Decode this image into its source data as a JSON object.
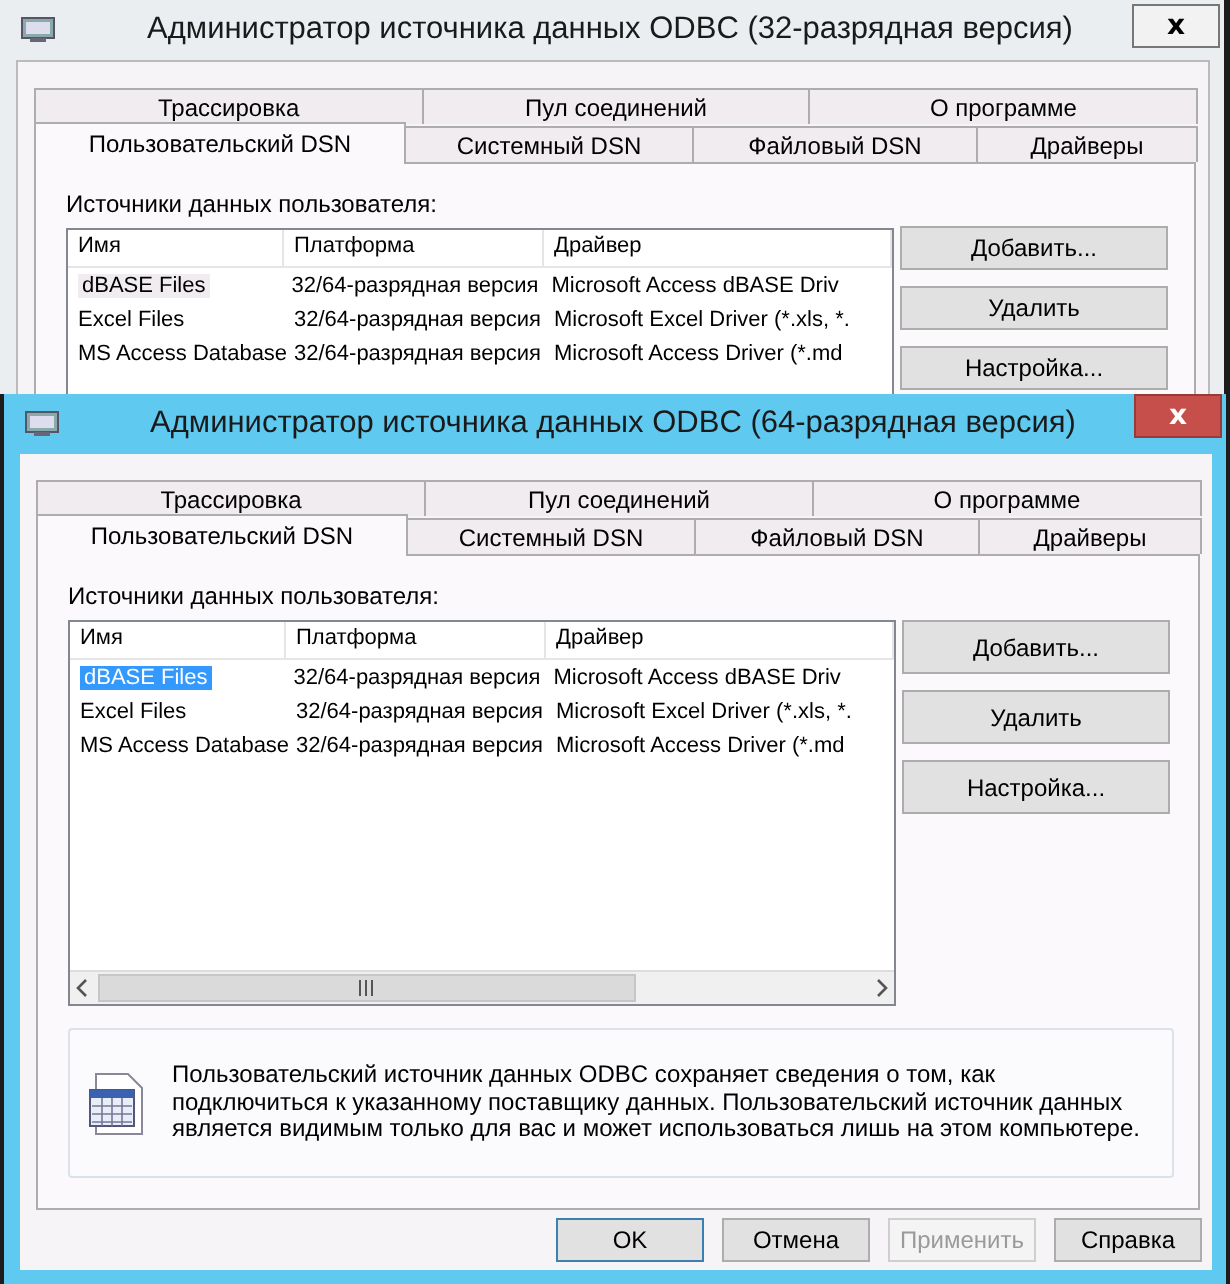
{
  "windows": [
    {
      "kind": "back",
      "active": false,
      "title": "Администратор источника данных ODBC (32-разрядная версия)",
      "close": "x",
      "tabs_top": [
        {
          "label": "Трассировка",
          "selected": false
        },
        {
          "label": "Пул соединений",
          "selected": false
        },
        {
          "label": "О программе",
          "selected": false
        }
      ],
      "tabs_bottom": [
        {
          "label": "Пользовательский DSN",
          "selected": true
        },
        {
          "label": "Системный DSN",
          "selected": false
        },
        {
          "label": "Файловый DSN",
          "selected": false
        },
        {
          "label": "Драйверы",
          "selected": false
        }
      ],
      "list_label": "Источники данных пользователя:",
      "table": {
        "columns": [
          "Имя",
          "Платформа",
          "Драйвер"
        ],
        "rows": [
          {
            "cells": [
              "dBASE Files",
              "32/64-разрядная версия",
              "Microsoft Access dBASE Driv"
            ],
            "selected": true
          },
          {
            "cells": [
              "Excel Files",
              "32/64-разрядная версия",
              "Microsoft Excel Driver (*.xls, *."
            ],
            "selected": false
          },
          {
            "cells": [
              "MS Access Database",
              "32/64-разрядная версия",
              "Microsoft Access Driver (*.md"
            ],
            "selected": false
          }
        ]
      },
      "side_buttons": [
        "Добавить...",
        "Удалить",
        "Настройка..."
      ]
    },
    {
      "kind": "front",
      "active": true,
      "title": "Администратор источника данных ODBC (64-разрядная версия)",
      "close": "x",
      "tabs_top": [
        {
          "label": "Трассировка",
          "selected": false
        },
        {
          "label": "Пул соединений",
          "selected": false
        },
        {
          "label": "О программе",
          "selected": false
        }
      ],
      "tabs_bottom": [
        {
          "label": "Пользовательский DSN",
          "selected": true
        },
        {
          "label": "Системный DSN",
          "selected": false
        },
        {
          "label": "Файловый DSN",
          "selected": false
        },
        {
          "label": "Драйверы",
          "selected": false
        }
      ],
      "list_label": "Источники данных пользователя:",
      "table": {
        "columns": [
          "Имя",
          "Платформа",
          "Драйвер"
        ],
        "rows": [
          {
            "cells": [
              "dBASE Files",
              "32/64-разрядная версия",
              "Microsoft Access dBASE Driv"
            ],
            "selected": true
          },
          {
            "cells": [
              "Excel Files",
              "32/64-разрядная версия",
              "Microsoft Excel Driver (*.xls, *."
            ],
            "selected": false
          },
          {
            "cells": [
              "MS Access Database",
              "32/64-разрядная версия",
              "Microsoft Access Driver (*.md"
            ],
            "selected": false
          }
        ]
      },
      "side_buttons": [
        "Добавить...",
        "Удалить",
        "Настройка..."
      ],
      "info": "Пользовательский источник данных ODBC сохраняет сведения о том, как подключиться к указанному поставщику данных.   Пользовательский источник данных является видимым только для вас и может использоваться лишь на этом компьютере.",
      "dialog_buttons": [
        {
          "label": "OK",
          "disabled": false
        },
        {
          "label": "Отмена",
          "disabled": false
        },
        {
          "label": "Применить",
          "disabled": true
        },
        {
          "label": "Справка",
          "disabled": false
        }
      ]
    }
  ]
}
